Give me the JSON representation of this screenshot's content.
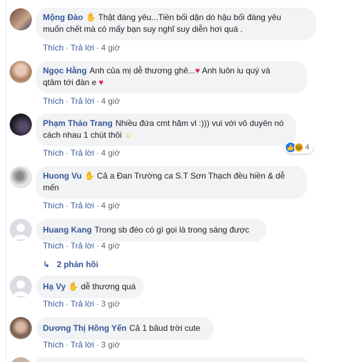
{
  "actions": {
    "like": "Thích",
    "reply": "Trả lời",
    "dot": "·"
  },
  "comments": [
    {
      "author": "Mộng Đào",
      "has_hand": true,
      "line1": "Thật đáng yêu...Tiền bối dặn dò hậu bối đáng yêu",
      "line2": "muốn chết mà có mấy bạn suy nghĩ suy diễn hơi quá .",
      "time": "4 giờ"
    },
    {
      "author": "Ngọc Hằng",
      "has_hand": false,
      "line1": "Anh của mị dễ thương ghê...",
      "line1b": "Anh luôn iu quý và",
      "line2": "qtâm tới đàn e",
      "time": "4 giờ",
      "heart": "♥"
    },
    {
      "author": "Phạm Thảo Trang",
      "has_hand": false,
      "line1": "Nhiều đứa cmt hãm vl :))) vui với vô duyên nó",
      "line2": "cách nhau 1 chút thôi",
      "smile": "☺",
      "time": "4 giờ",
      "reaction_count": "4"
    },
    {
      "author": "Huong Vu",
      "has_hand": true,
      "line1": "Cả a Đan Trường ca S.T Sơn Thạch đều hiền & dễ",
      "line2": "mến",
      "time": "4 giờ"
    },
    {
      "author": "Huang Kang",
      "has_hand": false,
      "line1": "Trong sb đéo có gì gọi là trong sáng được",
      "time": "4 giờ",
      "replies": "2 phản hồi"
    },
    {
      "author": "Hạ Vy",
      "has_hand": true,
      "line1": "dễ thương quá",
      "time": "3 giờ"
    },
    {
      "author": "Dương Thị Hồng Yến",
      "has_hand": false,
      "line1": "Cả 1 bâud trời cute",
      "time": "3 giờ"
    }
  ],
  "colors": {
    "author": "#385898",
    "bubble": "#f2f3f5",
    "meta": "#616770"
  }
}
